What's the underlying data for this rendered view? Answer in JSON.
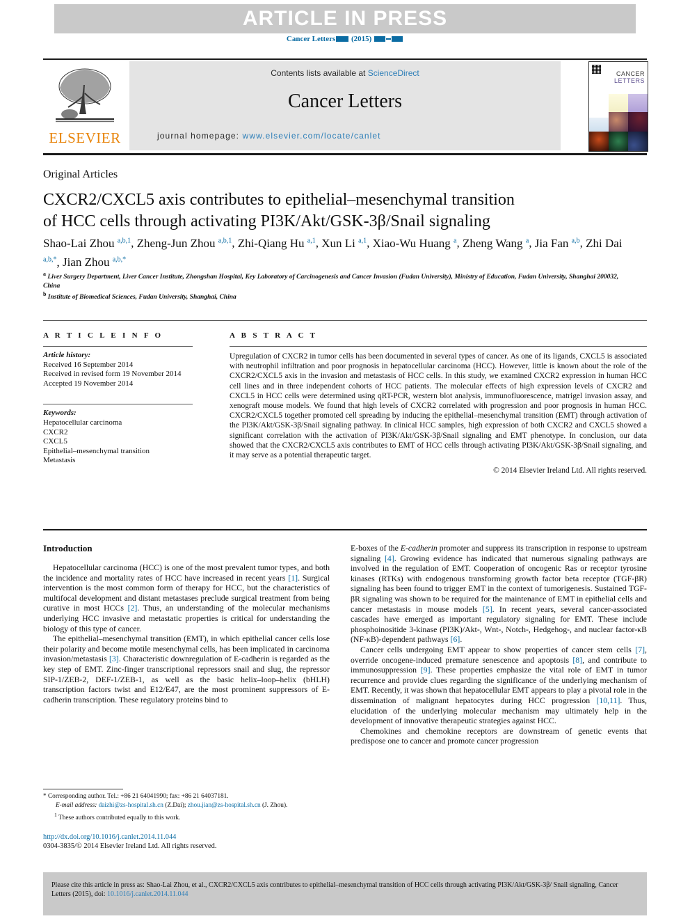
{
  "banner": {
    "text": "ARTICLE IN PRESS",
    "journal_line_prefix": "Cancer Letters",
    "journal_line_year": "(2015)",
    "color": "#0b6ca3"
  },
  "masthead": {
    "contents_text": "Contents lists available at",
    "sciencedirect": "ScienceDirect",
    "journal_title": "Cancer Letters",
    "homepage_label": "journal homepage:",
    "homepage_url": "www.elsevier.com/locate/canlet",
    "publisher": "ELSEVIER",
    "publisher_color": "#e8850c",
    "cover_title_line1": "CANCER",
    "cover_title_line2": "LETTERS",
    "tree_icon": "elsevier-tree-icon"
  },
  "article": {
    "section_type": "Original Articles",
    "title_line1": "CXCR2/CXCL5 axis contributes to epithelial–mesenchymal transition",
    "title_line2": "of HCC cells through activating PI3K/Akt/GSK-3β/Snail signaling",
    "authors_line1": "Shao-Lai Zhou",
    "authors": [
      {
        "name": "Shao-Lai Zhou",
        "sup": "a,b,1"
      },
      {
        "name": "Zheng-Jun Zhou",
        "sup": "a,b,1"
      },
      {
        "name": "Zhi-Qiang Hu",
        "sup": "a,1"
      },
      {
        "name": "Xun Li",
        "sup": "a,1"
      },
      {
        "name": "Xiao-Wu Huang",
        "sup": "a"
      },
      {
        "name": "Zheng Wang",
        "sup": "a"
      },
      {
        "name": "Jia Fan",
        "sup": "a,b"
      },
      {
        "name": "Zhi Dai",
        "sup": "a,b,*"
      },
      {
        "name": "Jian Zhou",
        "sup": "a,b,*"
      }
    ],
    "affiliation_a": "Liver Surgery Department, Liver Cancer Institute, Zhongshan Hospital, Key Laboratory of Carcinogenesis and Cancer Invasion (Fudan University), Ministry of Education, Fudan University, Shanghai 200032, China",
    "affiliation_b": "Institute of Biomedical Sciences, Fudan University, Shanghai, China"
  },
  "article_info": {
    "heading": "A R T I C L E   I N F O",
    "history_label": "Article history:",
    "history": [
      "Received 16 September 2014",
      "Received in revised form 19 November 2014",
      "Accepted 19 November 2014"
    ],
    "keywords_label": "Keywords:",
    "keywords": [
      "Hepatocellular carcinoma",
      "CXCR2",
      "CXCL5",
      "Epithelial–mesenchymal transition",
      "Metastasis"
    ]
  },
  "abstract": {
    "heading": "A B S T R A C T",
    "text": "Upregulation of CXCR2 in tumor cells has been documented in several types of cancer. As one of its ligands, CXCL5 is associated with neutrophil infiltration and poor prognosis in hepatocellular carcinoma (HCC). However, little is known about the role of the CXCR2/CXCL5 axis in the invasion and metastasis of HCC cells. In this study, we examined CXCR2 expression in human HCC cell lines and in three independent cohorts of HCC patients. The molecular effects of high expression levels of CXCR2 and CXCL5 in HCC cells were determined using qRT-PCR, western blot analysis, immunofluorescence, matrigel invasion assay, and xenograft mouse models. We found that high levels of CXCR2 correlated with progression and poor prognosis in human HCC. CXCR2/CXCL5 together promoted cell spreading by inducing the epithelial–mesenchymal transition (EMT) through activation of the PI3K/Akt/GSK-3β/Snail signaling pathway. In clinical HCC samples, high expression of both CXCR2 and CXCL5 showed a significant correlation with the activation of PI3K/Akt/GSK-3β/Snail signaling and EMT phenotype. In conclusion, our data showed that the CXCR2/CXCL5 axis contributes to EMT of HCC cells through activating PI3K/Akt/GSK-3β/Snail signaling, and it may serve as a potential therapeutic target.",
    "copyright": "© 2014 Elsevier Ireland Ltd. All rights reserved."
  },
  "body": {
    "intro_heading": "Introduction",
    "left_paragraphs": [
      {
        "parts": [
          {
            "t": "Hepatocellular carcinoma (HCC) is one of the most prevalent tumor types, and both the incidence and mortality rates of HCC have increased in recent years "
          },
          {
            "t": "[1]",
            "ref": true
          },
          {
            "t": ". Surgical intervention is the most common form of therapy for HCC, but the characteristics of multifocal development and distant metastases preclude surgical treatment from being curative in most HCCs "
          },
          {
            "t": "[2]",
            "ref": true
          },
          {
            "t": ". Thus, an understanding of the molecular mechanisms underlying HCC invasive and metastatic properties is critical for understanding the biology of this type of cancer."
          }
        ]
      },
      {
        "parts": [
          {
            "t": "The epithelial–mesenchymal transition (EMT), in which epithelial cancer cells lose their polarity and become motile mesenchymal cells, has been implicated in carcinoma invasion/metastasis "
          },
          {
            "t": "[3]",
            "ref": true
          },
          {
            "t": ". Characteristic downregulation of E-cadherin is regarded as the key step of EMT. Zinc-finger transcriptional repressors snail and slug, the repressor SIP-1/ZEB-2, DEF-1/ZEB-1, as well as the basic helix–loop–helix (bHLH) transcription factors twist and E12/E47, are the most prominent suppressors of E-cadherin transcription. These regulatory proteins bind to"
          }
        ]
      }
    ],
    "right_paragraphs": [
      {
        "noindent": true,
        "parts": [
          {
            "t": "E-boxes of the "
          },
          {
            "t": "E-cadherin",
            "ital": true
          },
          {
            "t": " promoter and suppress its transcription in response to upstream signaling "
          },
          {
            "t": "[4]",
            "ref": true
          },
          {
            "t": ". Growing evidence has indicated that numerous signaling pathways are involved in the regulation of EMT. Cooperation of oncogenic Ras or receptor tyrosine kinases (RTKs) with endogenous transforming growth factor beta receptor (TGF-βR) signaling has been found to trigger EMT in the context of tumorigenesis. Sustained TGF-βR signaling was shown to be required for the maintenance of EMT in epithelial cells and cancer metastasis in mouse models "
          },
          {
            "t": "[5]",
            "ref": true
          },
          {
            "t": ". In recent years, several cancer-associated cascades have emerged as important regulatory signaling for EMT. These include phosphoinositide 3-kinase (PI3K)/Akt-, Wnt-, Notch-, Hedgehog-, and nuclear factor-κB (NF-κB)-dependent pathways "
          },
          {
            "t": "[6]",
            "ref": true
          },
          {
            "t": "."
          }
        ]
      },
      {
        "parts": [
          {
            "t": "Cancer cells undergoing EMT appear to show properties of cancer stem cells "
          },
          {
            "t": "[7]",
            "ref": true
          },
          {
            "t": ", override oncogene-induced premature senescence and apoptosis "
          },
          {
            "t": "[8]",
            "ref": true
          },
          {
            "t": ", and contribute to immunosuppression "
          },
          {
            "t": "[9]",
            "ref": true
          },
          {
            "t": ". These properties emphasize the vital role of EMT in tumor recurrence and provide clues regarding the significance of the underlying mechanism of EMT. Recently, it was shown that hepatocellular EMT appears to play a pivotal role in the dissemination of malignant hepatocytes during HCC progression "
          },
          {
            "t": "[10,11]",
            "ref": true
          },
          {
            "t": ". Thus, elucidation of the underlying molecular mechanism may ultimately help in the development of innovative therapeutic strategies against HCC."
          }
        ]
      },
      {
        "parts": [
          {
            "t": "Chemokines and chemokine receptors are downstream of genetic events that predispose one to cancer and promote cancer progression"
          }
        ]
      }
    ]
  },
  "footnotes": {
    "corresponding": "Corresponding author. Tel.: +86 21 64041990; fax: +86 21 64037181.",
    "email_label": "E-mail address:",
    "email1": "daizhi@zs-hospital.sh.cn",
    "email1_owner": "(Z.Dai);",
    "email2": "zhou.jian@zs-hospital.sh.cn",
    "email2_owner": "(J. Zhou).",
    "equal_contrib": "These authors contributed equally to this work.",
    "doi_url": "http://dx.doi.org/10.1016/j.canlet.2014.11.044",
    "issn_copyright": "0304-3835/© 2014 Elsevier Ireland Ltd. All rights reserved."
  },
  "cite_box": {
    "text": "Please cite this article in press as: Shao-Lai Zhou, et al., CXCR2/CXCL5 axis contributes to epithelial–mesenchymal transition of HCC cells through activating PI3K/Akt/GSK-3β/ Snail signaling, Cancer Letters (2015), doi:",
    "doi": "10.1016/j.canlet.2014.11.044"
  }
}
